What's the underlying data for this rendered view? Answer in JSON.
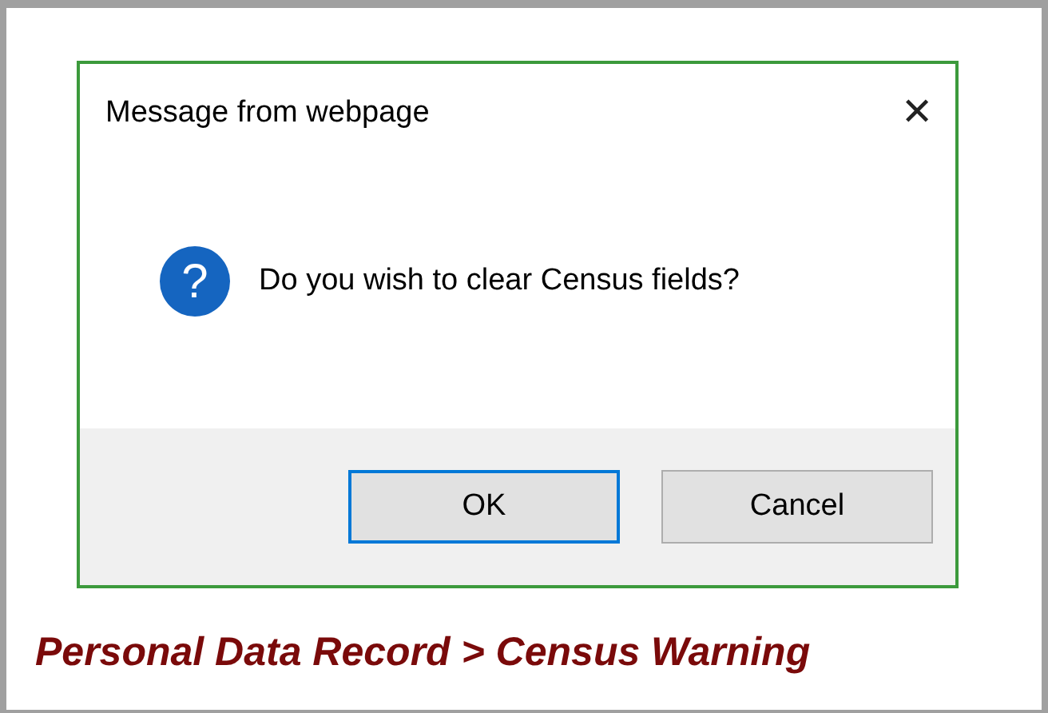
{
  "dialog": {
    "title": "Message from webpage",
    "close": "✕",
    "message": "Do you wish to clear Census fields?",
    "icon": "?",
    "buttons": [
      {
        "label": "OK",
        "selected": true
      },
      {
        "label": "Cancel",
        "selected": false
      }
    ]
  },
  "caption": "Personal Data Record > Census Warning"
}
